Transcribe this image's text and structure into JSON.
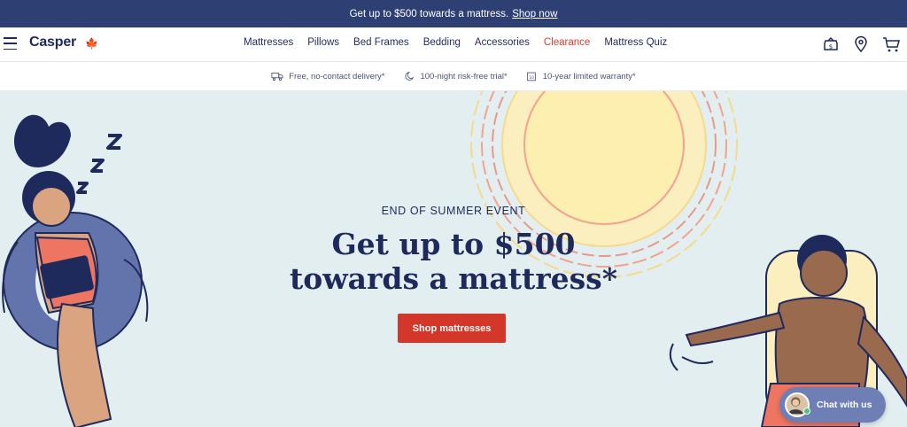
{
  "promo": {
    "text": "Get up to $500 towards a mattress.",
    "link": "Shop now"
  },
  "nav": {
    "logo": "Casper",
    "maple_icon": "maple-leaf-icon",
    "links": [
      "Mattresses",
      "Pillows",
      "Bed Frames",
      "Bedding",
      "Accessories",
      "Clearance",
      "Mattress Quiz"
    ],
    "highlight_color": "#e0392b",
    "icons": [
      "financing-icon",
      "location-icon",
      "cart-icon"
    ]
  },
  "benefits": [
    {
      "icon": "delivery-truck-icon",
      "text": "Free, no-contact delivery*"
    },
    {
      "icon": "moon-icon",
      "text": "100-night risk-free trial*"
    },
    {
      "icon": "calendar-icon",
      "text": "10-year limited warranty*"
    }
  ],
  "hero": {
    "eyebrow": "END OF SUMMER EVENT",
    "headline_line1": "Get up to $500",
    "headline_line2": "towards a mattress*",
    "cta": "Shop mattresses",
    "background": "#e2eef0",
    "cta_color": "#d3372a"
  },
  "chat": {
    "label": "Chat with us"
  },
  "colors": {
    "navy": "#1f2a5c",
    "promo_bar": "#2e3f73"
  }
}
